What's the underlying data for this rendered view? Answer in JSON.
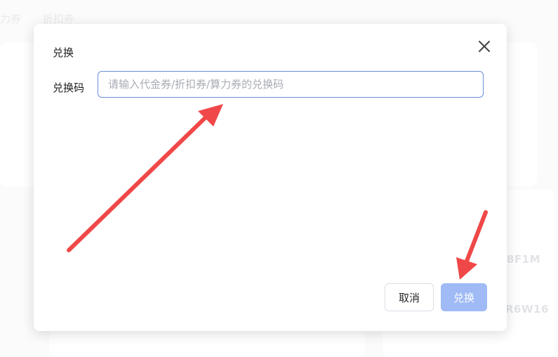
{
  "background": {
    "tabs": [
      "力券",
      "折扣券"
    ],
    "codes": [
      "8F1M",
      "R6W16"
    ]
  },
  "dialog": {
    "title": "兑换",
    "field_label": "兑换码",
    "input_value": "",
    "input_placeholder": "请输入代金券/折扣券/算力券的兑换码",
    "cancel_label": "取消",
    "confirm_label": "兑换",
    "confirm_disabled": true,
    "close_icon": "close-icon"
  },
  "annotations": {
    "arrow_color": "#f04848",
    "arrows": [
      "pointing-to-input",
      "pointing-to-confirm-button"
    ]
  },
  "colors": {
    "accent_border": "#6a8fd6",
    "confirm_disabled_bg": "#9fbaf5"
  }
}
